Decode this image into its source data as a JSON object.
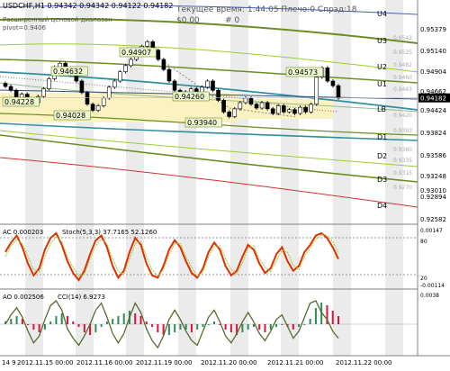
{
  "header": {
    "symbol_line": "USDCHF,H1  0.94342 0.94342 0.94122 0.94182",
    "indicator_name": "Расширенный ценовой диапазон",
    "pivot": "pivot=0.9406",
    "time_label": "Текущее время: 1:44:05 Плечо:0 Спрэд:18",
    "balance": "$0.00",
    "hash": "# 0"
  },
  "price_axis": [
    "0.95379",
    "0.95140",
    "0.94904",
    "0.94662",
    "0.94424",
    "0.94182",
    "0.93824",
    "0.93586",
    "0.93248",
    "0.93010",
    "0.92894",
    "0.92582"
  ],
  "price_tags": [
    "0.9543",
    "0.9525",
    "0.9482",
    "0.9460",
    "0.9443",
    "0.9420",
    "0.9393",
    "0.9360",
    "0.9335",
    "0.9315",
    "0.9270"
  ],
  "levels": [
    "U4",
    "U3",
    "U2",
    "U1",
    "LB",
    "D1",
    "D2",
    "D3",
    "D4"
  ],
  "price_labels": [
    "0.94228",
    "0.94632",
    "0.94907",
    "0.94028",
    "0.94260",
    "0.93940",
    "0.94573"
  ],
  "ac_panel": {
    "label": "AC 0.000203",
    "stoch_label": "Stoch(5,3,3) 37.7165 52.1260",
    "axis": [
      "0.00147",
      "80",
      "20",
      "-0.00114"
    ]
  },
  "ao_panel": {
    "label": "AO 0.002506",
    "cci_label": "CCI(14) 6.9273",
    "axis": [
      "0.0038"
    ]
  },
  "time_axis": [
    "14 9",
    "2012.11.15 00:00",
    "2012.11.16 00:00",
    "2012.11.19 00:00",
    "2012.11.20 00:00",
    "2012.11.21 00:00",
    "2012.11.22 00:00"
  ],
  "chart_data": {
    "type": "candlestick",
    "symbol": "USDCHF",
    "timeframe": "H1",
    "ohlc_last": {
      "open": 0.94342,
      "high": 0.94342,
      "low": 0.94122,
      "close": 0.94182
    },
    "current_price": 0.94182,
    "close": [
      0.9433,
      0.9428,
      0.9418,
      0.9423,
      0.941,
      0.9412,
      0.942,
      0.943,
      0.9443,
      0.9458,
      0.9463,
      0.9455,
      0.9448,
      0.944,
      0.9425,
      0.941,
      0.9402,
      0.9408,
      0.9418,
      0.9432,
      0.944,
      0.9452,
      0.946,
      0.9468,
      0.9476,
      0.9485,
      0.9491,
      0.948,
      0.9468,
      0.9455,
      0.944,
      0.9428,
      0.9426,
      0.942,
      0.943,
      0.9425,
      0.9432,
      0.944,
      0.9428,
      0.9415,
      0.94,
      0.9394,
      0.9404,
      0.9412,
      0.9418,
      0.941,
      0.9405,
      0.9412,
      0.9404,
      0.9398,
      0.9408,
      0.94,
      0.9403,
      0.9398,
      0.9406,
      0.94,
      0.941,
      0.9445,
      0.9457,
      0.944,
      0.9434,
      0.9418
    ],
    "osc_ac": [
      0.2,
      0.6,
      0.9,
      0.4,
      -0.3,
      -0.8,
      -0.5,
      0.3,
      0.8,
      1.0,
      0.5,
      -0.2,
      -0.7,
      -1.0,
      -0.6,
      0.1,
      0.7,
      0.9,
      0.4,
      -0.4,
      -0.9,
      -0.6,
      0.2,
      0.8,
      0.5,
      -0.3,
      -0.8,
      -0.9,
      -0.4,
      0.3,
      0.7,
      0.4,
      -0.2,
      -0.7,
      -0.9,
      -0.5,
      0.2,
      0.6,
      0.3,
      -0.4,
      -0.8,
      -0.6,
      0.0,
      0.5,
      0.3,
      -0.3,
      -0.7,
      -0.5,
      0.1,
      0.4,
      -0.2,
      -0.6,
      -0.4,
      0.2,
      0.5,
      0.9,
      1.0,
      0.8,
      0.4,
      -0.1
    ],
    "osc_stoch": [
      0.0,
      0.5,
      0.8,
      0.6,
      0.0,
      -0.6,
      -0.7,
      0.0,
      0.6,
      0.9,
      0.7,
      0.0,
      -0.5,
      -0.9,
      -0.8,
      -0.1,
      0.5,
      0.8,
      0.6,
      -0.1,
      -0.7,
      -0.8,
      -0.1,
      0.6,
      0.7,
      0.0,
      -0.6,
      -0.9,
      -0.6,
      0.1,
      0.6,
      0.6,
      0.0,
      -0.5,
      -0.9,
      -0.7,
      0.0,
      0.5,
      0.5,
      -0.1,
      -0.6,
      -0.8,
      -0.3,
      0.4,
      0.5,
      -0.1,
      -0.5,
      -0.7,
      -0.2,
      0.3,
      0.2,
      -0.4,
      -0.6,
      0.0,
      0.4,
      0.8,
      1.0,
      1.0,
      0.7,
      0.2
    ],
    "osc_ao": [
      0.1,
      0.2,
      0.3,
      0.2,
      0.0,
      -0.2,
      -0.3,
      -0.2,
      0.1,
      0.3,
      0.4,
      0.3,
      0.1,
      -0.1,
      -0.3,
      -0.4,
      -0.3,
      -0.1,
      0.1,
      0.2,
      0.3,
      0.4,
      0.5,
      0.4,
      0.3,
      0.1,
      -0.1,
      -0.3,
      -0.4,
      -0.4,
      -0.3,
      -0.2,
      -0.2,
      -0.3,
      -0.2,
      -0.1,
      0.0,
      0.1,
      0.0,
      -0.2,
      -0.3,
      -0.4,
      -0.3,
      -0.2,
      -0.1,
      -0.2,
      -0.3,
      -0.2,
      -0.1,
      0.0,
      -0.1,
      -0.2,
      -0.1,
      0.0,
      0.2,
      0.6,
      0.8,
      0.7,
      0.5,
      0.3
    ],
    "osc_cci": [
      0.0,
      0.4,
      0.7,
      0.3,
      -0.3,
      -0.8,
      -0.5,
      0.2,
      0.8,
      1.0,
      0.6,
      -0.2,
      -0.6,
      -0.9,
      -0.5,
      0.0,
      0.6,
      0.9,
      0.3,
      -0.4,
      -0.8,
      -0.4,
      0.3,
      0.9,
      0.5,
      -0.2,
      -0.7,
      -1.0,
      -0.5,
      0.2,
      0.6,
      0.2,
      -0.3,
      -0.7,
      -0.9,
      -0.3,
      0.3,
      0.6,
      0.1,
      -0.5,
      -0.8,
      -0.4,
      0.1,
      0.5,
      0.1,
      -0.4,
      -0.7,
      -0.3,
      0.2,
      0.4,
      -0.1,
      -0.6,
      -0.3,
      0.3,
      0.9,
      1.0,
      0.5,
      0.2,
      -0.3,
      -0.6
    ]
  }
}
